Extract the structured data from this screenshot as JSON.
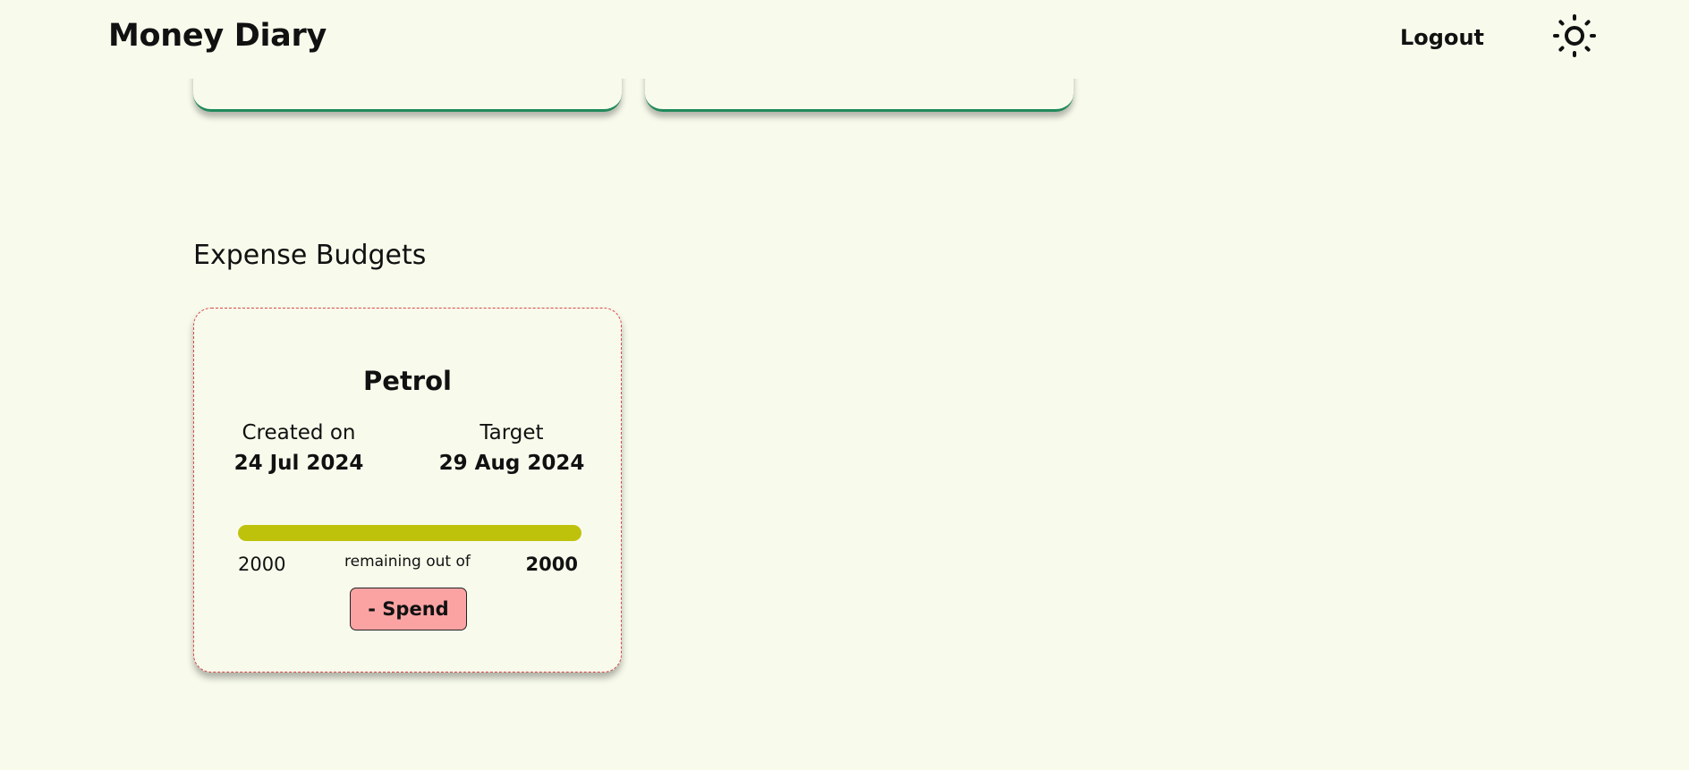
{
  "header": {
    "brand": "Money Diary",
    "logout_label": "Logout",
    "theme_icon": "sun-icon"
  },
  "expense_budgets": {
    "section_title": "Expense Budgets",
    "budgets": [
      {
        "name": "Petrol",
        "created_label": "Created on",
        "created_date": "24 Jul 2024",
        "target_label": "Target",
        "target_date": "29 Aug 2024",
        "remaining": "2000",
        "remaining_text": "remaining out of",
        "total": "2000",
        "remaining_fraction": 1.0,
        "progress_color": "#bfc20a",
        "border_color": "#d94a4a",
        "spend_label": "- Spend",
        "spend_color": "#fba3a3"
      }
    ]
  },
  "colors": {
    "background": "#f8fbec",
    "previous_card_accent": "#1f8a5b"
  }
}
